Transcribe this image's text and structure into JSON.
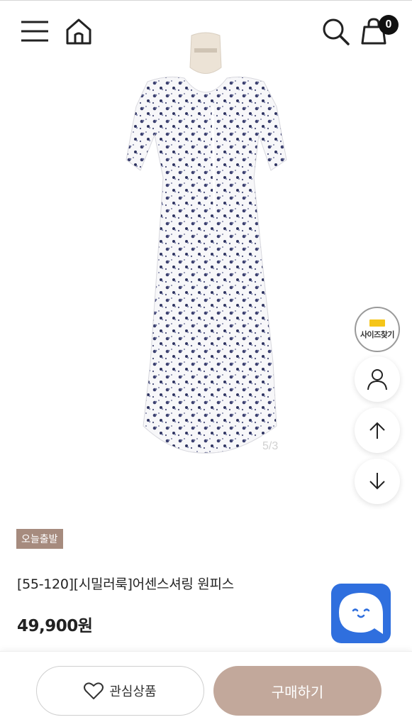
{
  "header": {
    "cart_count": "0"
  },
  "product": {
    "image_alt": "white floral print midi dress",
    "image_counter": "5/3",
    "badge": "오늘출발",
    "title": "[55-120][시밀러룩]어센스셔링 원피스",
    "price": "49,900원"
  },
  "side_buttons": {
    "size_finder_label": "사이즈찾기"
  },
  "bottom_bar": {
    "wishlist_label": "관심상품",
    "buy_label": "구매하기"
  },
  "colors": {
    "accent": "#c2a89b",
    "badge": "#a68b7e",
    "chat": "#2f6fde"
  },
  "icons": [
    "menu-icon",
    "home-icon",
    "search-icon",
    "cart-icon",
    "user-icon",
    "arrow-up-icon",
    "arrow-down-icon",
    "heart-icon",
    "chat-icon"
  ]
}
